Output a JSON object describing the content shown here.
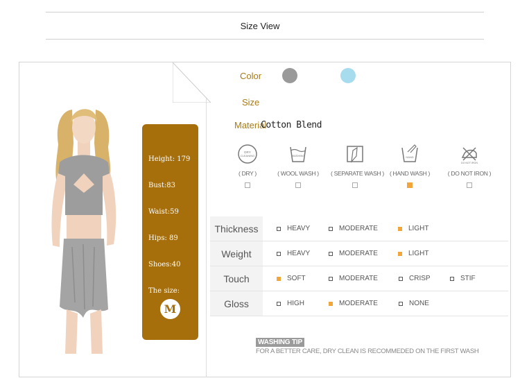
{
  "header": {
    "title": "Size View"
  },
  "spec": {
    "height": "Height: 179",
    "bust": "Bust:83",
    "waist": "Waist:59",
    "hips": "Hips: 89",
    "shoes": "Shoes:40",
    "size_label": "The size:",
    "size_value": "M"
  },
  "product": {
    "color_label": "Color",
    "colors": [
      "#9a9a9a",
      "#a7dcee"
    ],
    "size_label": "Size",
    "material_label": "Material",
    "material_value": "Cotton Blend"
  },
  "care": [
    {
      "icon": "dry-cleaning-icon",
      "label": "( DRY )",
      "checked": false
    },
    {
      "icon": "wool-wash-icon",
      "label": "( WOOL WASH )",
      "checked": false
    },
    {
      "icon": "separate-wash-icon",
      "label": "( SEPARATE WASH )",
      "checked": false
    },
    {
      "icon": "hand-wash-icon",
      "label": "( HAND WASH )",
      "checked": true
    },
    {
      "icon": "do-not-iron-icon",
      "label": "( DO NOT IRON )",
      "checked": false
    }
  ],
  "properties": [
    {
      "name": "Thickness",
      "options": [
        {
          "label": "HEAVY",
          "on": false
        },
        {
          "label": "MODERATE",
          "on": false
        },
        {
          "label": "LIGHT",
          "on": true
        }
      ]
    },
    {
      "name": "Weight",
      "options": [
        {
          "label": "HEAVY",
          "on": false
        },
        {
          "label": "MODERATE",
          "on": false
        },
        {
          "label": "LIGHT",
          "on": true
        }
      ]
    },
    {
      "name": "Touch",
      "options": [
        {
          "label": "SOFT",
          "on": true
        },
        {
          "label": "MODERATE",
          "on": false
        },
        {
          "label": "CRISP",
          "on": false
        },
        {
          "label": "STIF",
          "on": false
        }
      ]
    },
    {
      "name": "Gloss",
      "options": [
        {
          "label": "HIGH",
          "on": false
        },
        {
          "label": "MODERATE",
          "on": true
        },
        {
          "label": "NONE",
          "on": false
        }
      ]
    }
  ],
  "washing": {
    "title": "WASHING TIP",
    "text": "FOR A BETTER CARE, DRY CLEAN IS RECOMMEDED ON THE FIRST WASH"
  },
  "theme": {
    "accent": "#a66f0b",
    "check": "#f2a53a"
  }
}
